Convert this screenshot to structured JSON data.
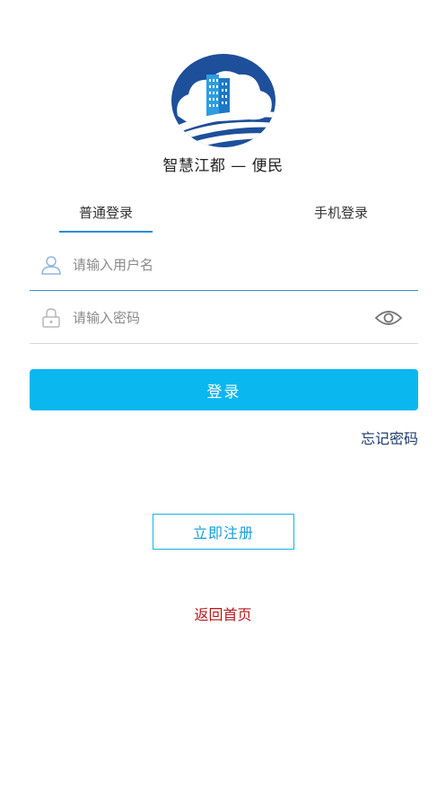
{
  "app": {
    "name": "智慧江都 — 便民"
  },
  "tabs": [
    {
      "label": "普通登录",
      "active": true
    },
    {
      "label": "手机登录",
      "active": false
    }
  ],
  "form": {
    "username_placeholder": "请输入用户名",
    "username_value": "",
    "password_placeholder": "请输入密码",
    "password_value": ""
  },
  "actions": {
    "login_label": "登录",
    "forgot_label": "忘记密码",
    "register_label": "立即注册",
    "back_label": "返回首页"
  },
  "colors": {
    "accent": "#0ab7ef",
    "tab_indicator": "#2b8ad6",
    "forgot_text": "#1f3c6e",
    "back_text": "#b5161c"
  },
  "icons": {
    "logo": "city-cloud-logo",
    "username": "user-icon",
    "password": "lock-icon",
    "toggle_visibility": "eye-icon"
  }
}
